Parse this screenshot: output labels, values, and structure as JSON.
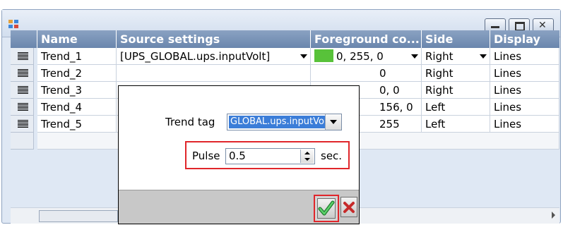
{
  "window": {
    "title": ""
  },
  "columns": [
    {
      "label": "Name"
    },
    {
      "label": "Source settings"
    },
    {
      "label": "Foreground co..."
    },
    {
      "label": "Side"
    },
    {
      "label": "Display"
    }
  ],
  "rows": [
    {
      "name": "Trend_1",
      "source": "[UPS_GLOBAL.ups.inputVolt]",
      "foreground": "0, 255, 0",
      "side": "Right",
      "display": "Lines"
    },
    {
      "name": "Trend_2",
      "source": "",
      "foreground": "0",
      "side": "Right",
      "display": "Lines"
    },
    {
      "name": "Trend_3",
      "source": "",
      "foreground": "0, 0",
      "side": "Right",
      "display": "Lines"
    },
    {
      "name": "Trend_4",
      "source": "",
      "foreground": "156, 0",
      "side": "Left",
      "display": "Lines"
    },
    {
      "name": "Trend_5",
      "source": "",
      "foreground": "255",
      "side": "Left",
      "display": "Lines"
    }
  ],
  "popup": {
    "trend_tag_label": "Trend tag",
    "trend_tag_value": "GLOBAL.ups.inputVolt",
    "pulse_label": "Pulse",
    "pulse_value": "0.5",
    "pulse_unit": "sec."
  },
  "colors": {
    "header_bg": "#7b94b8",
    "trend1_swatch": "#58c23a",
    "highlight_red": "#e0262b",
    "selection_blue": "#3b7dd8"
  },
  "icons": [
    "app-icon",
    "minimize-icon",
    "maximize-icon",
    "close-icon",
    "row-header-icon",
    "dropdown-arrow-icon",
    "spin-up-icon",
    "spin-down-icon",
    "checkmark-icon",
    "cancel-x-icon",
    "scroll-right-icon"
  ]
}
